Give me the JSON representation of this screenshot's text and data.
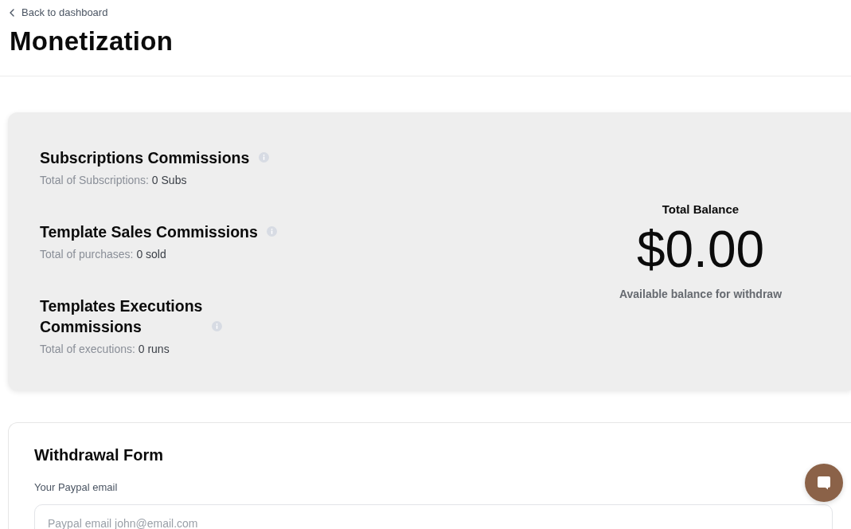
{
  "back_link": {
    "label": "Back to dashboard"
  },
  "page_title": "Monetization",
  "commissions": [
    {
      "title": "Subscriptions Commissions",
      "stat_label": "Total of Subscriptions:",
      "stat_value": "0 Subs"
    },
    {
      "title": "Template Sales Commissions",
      "stat_label": "Total of purchases:",
      "stat_value": "0 sold"
    },
    {
      "title": "Templates Executions Commissions",
      "stat_label": "Total of executions:",
      "stat_value": "0 runs"
    }
  ],
  "balance": {
    "title": "Total Balance",
    "amount": "$0.00",
    "caption": "Available balance for withdraw"
  },
  "withdrawal_form": {
    "title": "Withdrawal Form",
    "fields": [
      {
        "label": "Your Paypal email",
        "placeholder": "Paypal email john@email.com"
      }
    ]
  }
}
